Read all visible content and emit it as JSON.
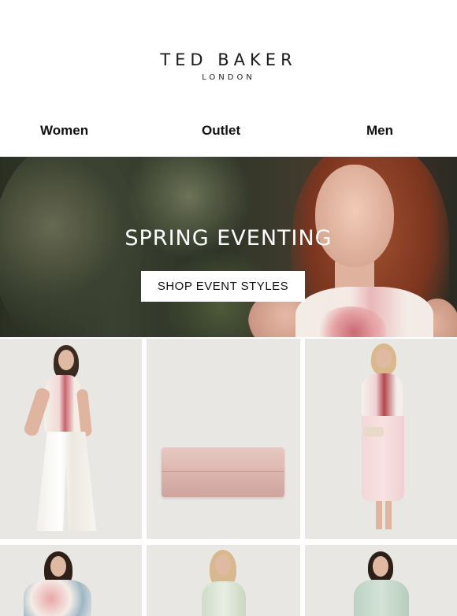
{
  "brand": {
    "name": "TED BAKER",
    "sub": "LONDON"
  },
  "nav": {
    "women": "Women",
    "outlet": "Outlet",
    "men": "Men"
  },
  "hero": {
    "title": "SPRING EVENTING",
    "cta": "SHOP EVENT STYLES"
  },
  "colors": {
    "background": "#ffffff",
    "text": "#111111",
    "tile_background": "#e9e7e4"
  }
}
